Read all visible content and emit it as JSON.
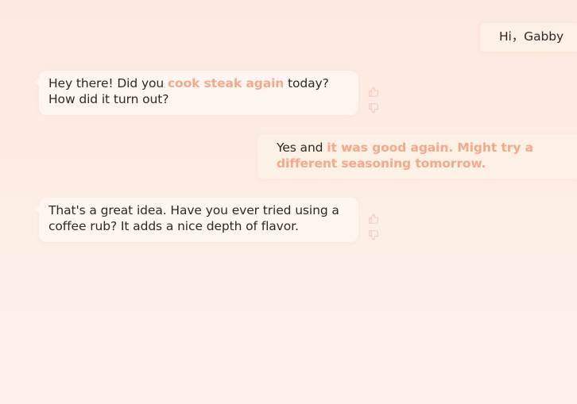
{
  "chat": {
    "messages": [
      {
        "role": "user",
        "parts": [
          {
            "text": "Hi，Gabby",
            "highlight": false
          }
        ]
      },
      {
        "role": "assistant",
        "parts": [
          {
            "text": "Hey there! Did you ",
            "highlight": false
          },
          {
            "text": "cook steak again",
            "highlight": true
          },
          {
            "text": " today? How did it turn out?",
            "highlight": false
          }
        ],
        "feedback_icons": [
          "thumbs-up-icon",
          "thumbs-down-icon"
        ]
      },
      {
        "role": "user",
        "parts": [
          {
            "text": "Yes and ",
            "highlight": false
          },
          {
            "text": "it was good again. Might try a different seasoning tomorrow.",
            "highlight": true
          }
        ]
      },
      {
        "role": "assistant",
        "parts": [
          {
            "text": "That's a great idea. Have you ever tried using a coffee rub? It adds a nice depth of flavor.",
            "highlight": false
          }
        ],
        "feedback_icons": [
          "thumbs-up-icon",
          "thumbs-down-icon"
        ]
      }
    ]
  },
  "colors": {
    "background_top": "#fde9e0",
    "background_bottom": "#fdf1ea",
    "user_bubble": "#fdf0e4",
    "assistant_bubble": "#fff6f1",
    "highlight_text": "#f4a98b",
    "body_text": "#2d2a28",
    "feedback_icon": "#f1cbbb"
  }
}
